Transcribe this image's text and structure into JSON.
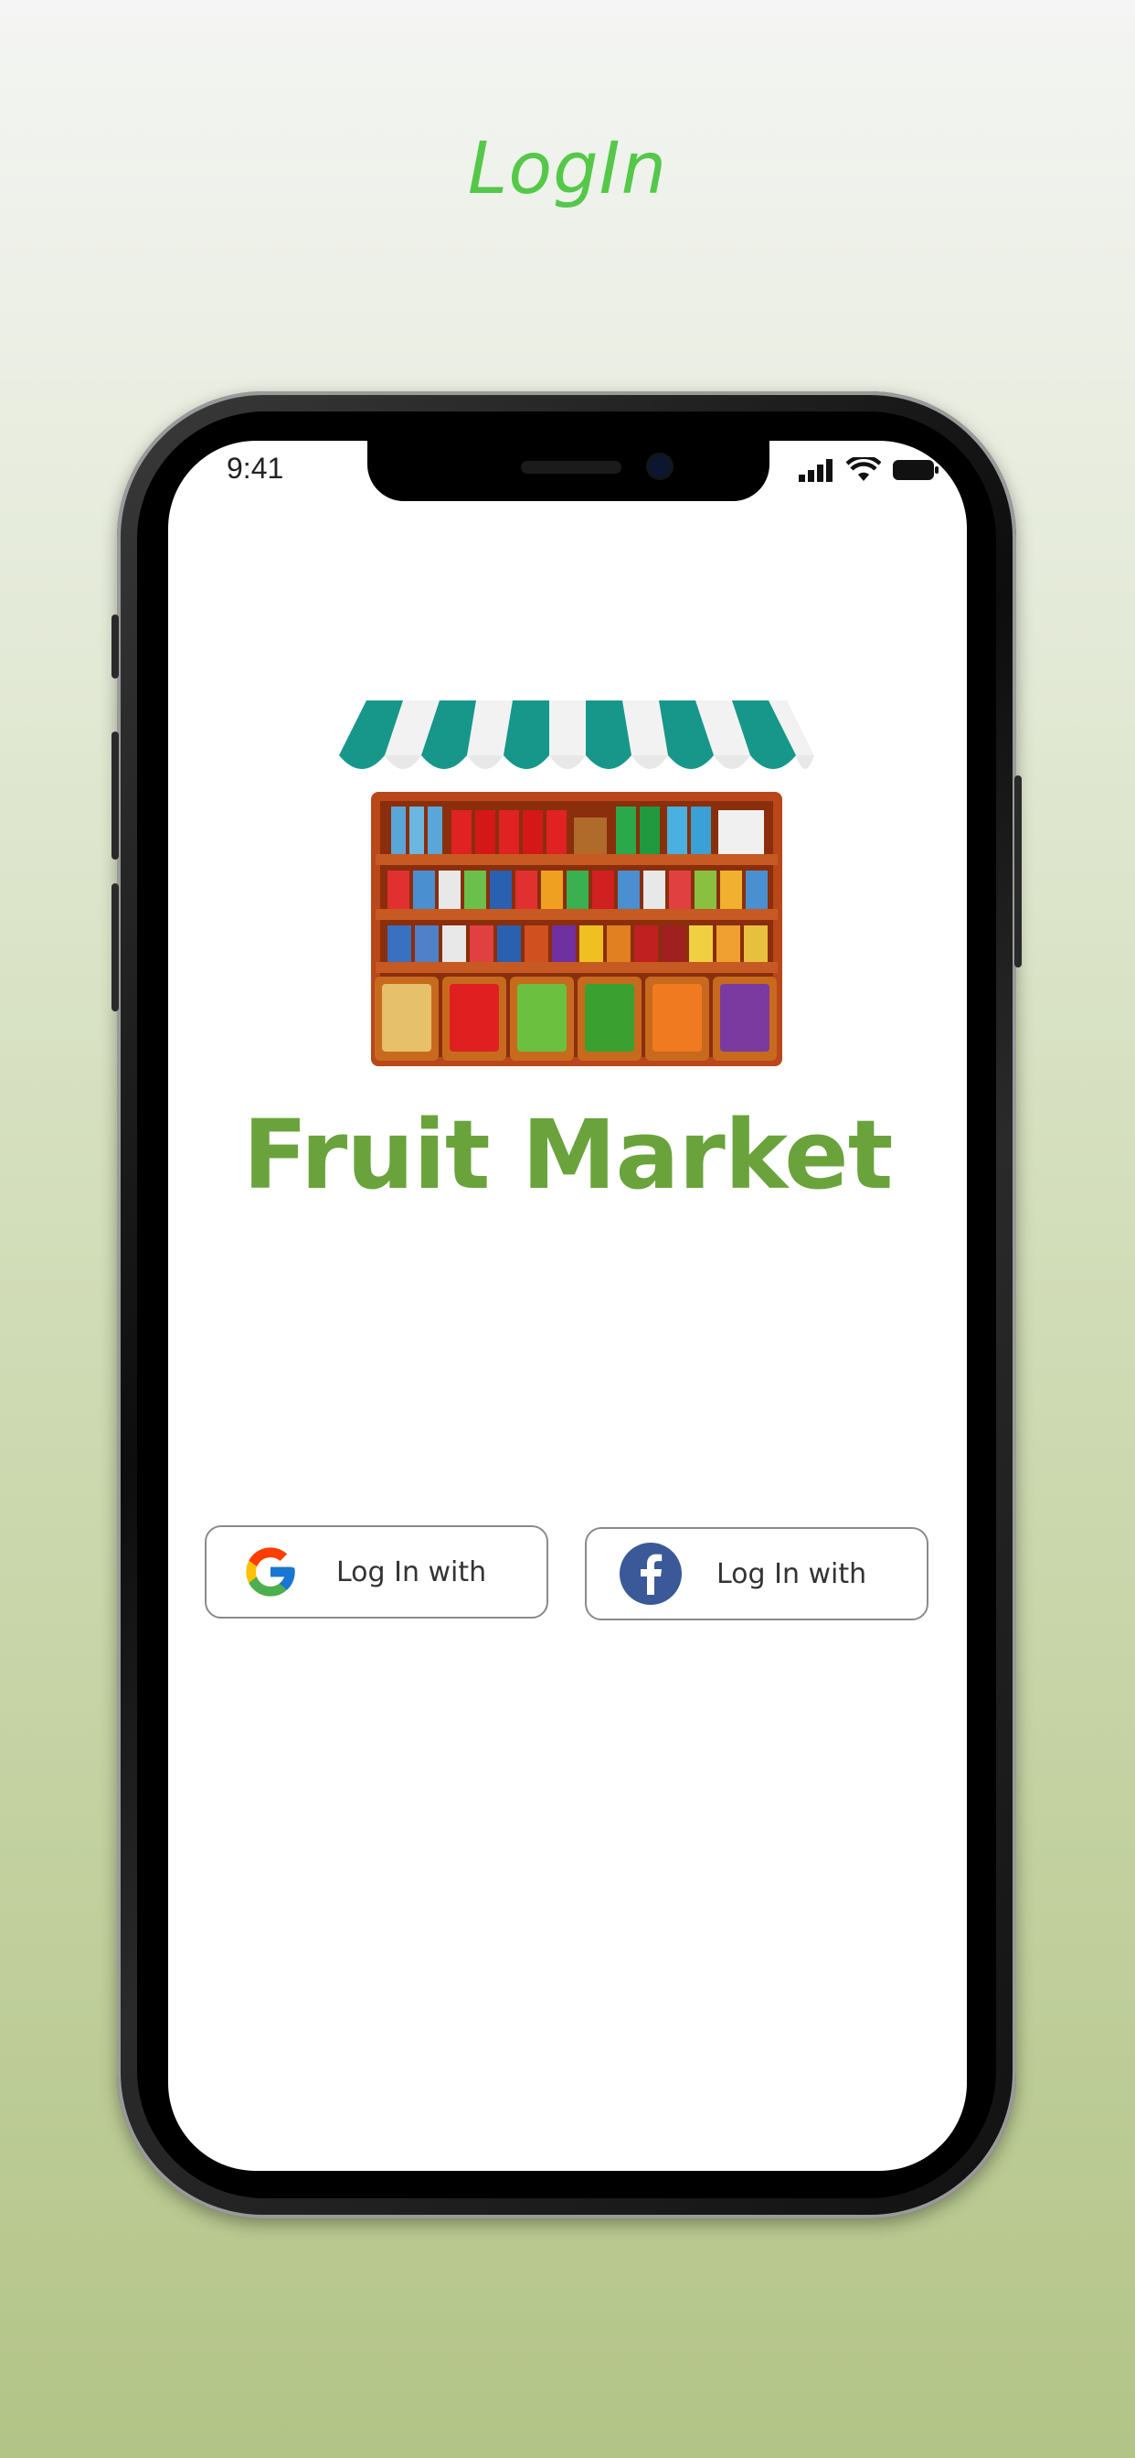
{
  "heading": "LogIn",
  "status_bar": {
    "time": "9:41"
  },
  "app": {
    "title": "Fruit Market"
  },
  "buttons": {
    "google": {
      "label": "Log In with",
      "icon": "google-icon"
    },
    "facebook": {
      "label": "Log In with",
      "icon": "facebook-icon"
    }
  },
  "colors": {
    "heading": "#55c84a",
    "brand": "#6aa33c",
    "awning": "#17978a",
    "facebook": "#3b5998"
  }
}
